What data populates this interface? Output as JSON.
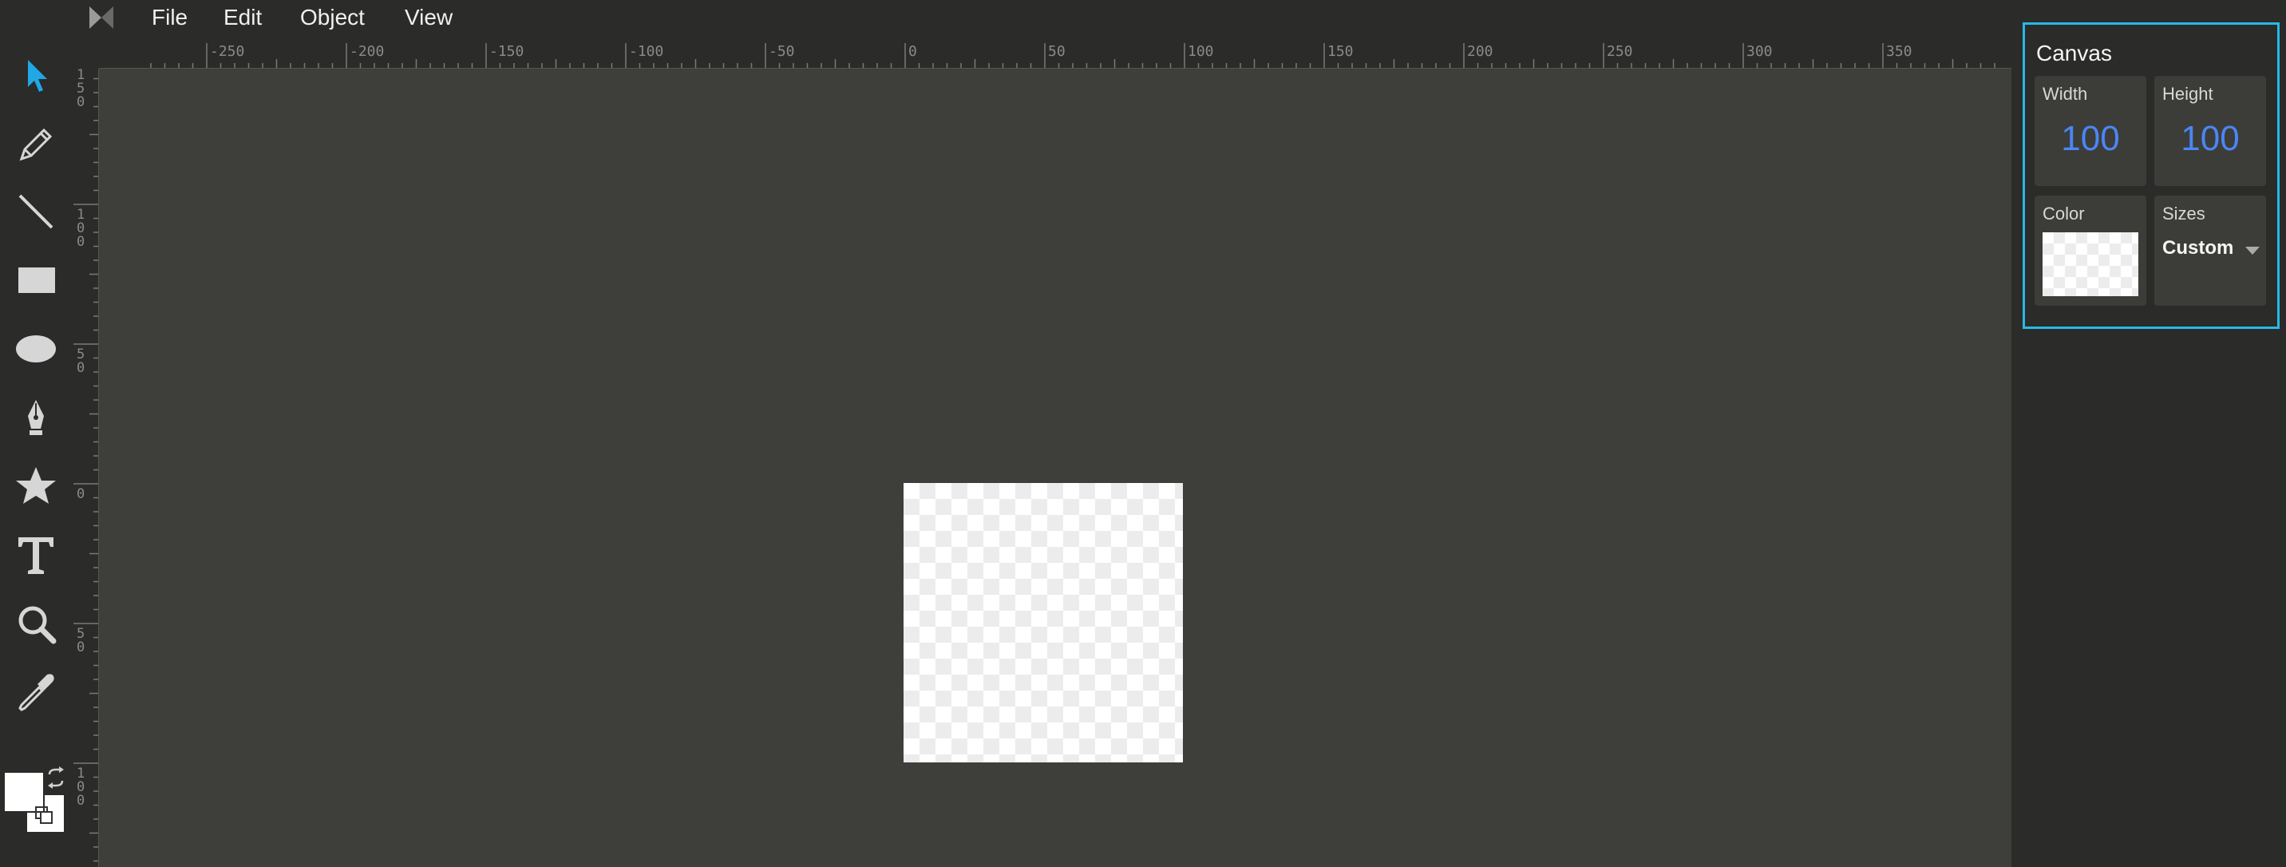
{
  "menubar": {
    "logo_icon": "method-draw-logo-icon",
    "items": [
      {
        "label": "File"
      },
      {
        "label": "Edit"
      },
      {
        "label": "Object"
      },
      {
        "label": "View"
      }
    ]
  },
  "toolbar": {
    "tools": [
      {
        "name": "select",
        "icon": "pointer-arrow-icon",
        "active": true
      },
      {
        "name": "pencil",
        "icon": "pencil-icon"
      },
      {
        "name": "line",
        "icon": "line-icon"
      },
      {
        "name": "rectangle",
        "icon": "rectangle-icon"
      },
      {
        "name": "ellipse",
        "icon": "ellipse-icon"
      },
      {
        "name": "path",
        "icon": "pen-nib-icon"
      },
      {
        "name": "shapes",
        "icon": "star-icon"
      },
      {
        "name": "text",
        "icon": "text-icon"
      },
      {
        "name": "zoom",
        "icon": "magnifier-icon"
      },
      {
        "name": "eyedropper",
        "icon": "eyedropper-icon"
      }
    ],
    "fill_color": "#ffffff",
    "stroke_color": "#ffffff"
  },
  "ruler_h": {
    "labels": [
      "-250",
      "-200",
      "-150",
      "-100",
      "-50",
      "0",
      "50",
      "100",
      "150",
      "200",
      "250",
      "300",
      "350"
    ]
  },
  "ruler_v": {
    "labels": [
      "1\n5\n0",
      "1\n0\n0",
      "5\n0",
      "0",
      "5\n0",
      "1\n0\n0"
    ]
  },
  "panel": {
    "title": "Canvas",
    "width_label": "Width",
    "width_value": "100",
    "height_label": "Height",
    "height_value": "100",
    "color_label": "Color",
    "sizes_label": "Sizes",
    "sizes_value": "Custom"
  },
  "colors": {
    "accent": "#28b9e8",
    "value_blue": "#4a86f5",
    "active_tool": "#1fa7e6",
    "workspace": "#3e3e3a"
  }
}
